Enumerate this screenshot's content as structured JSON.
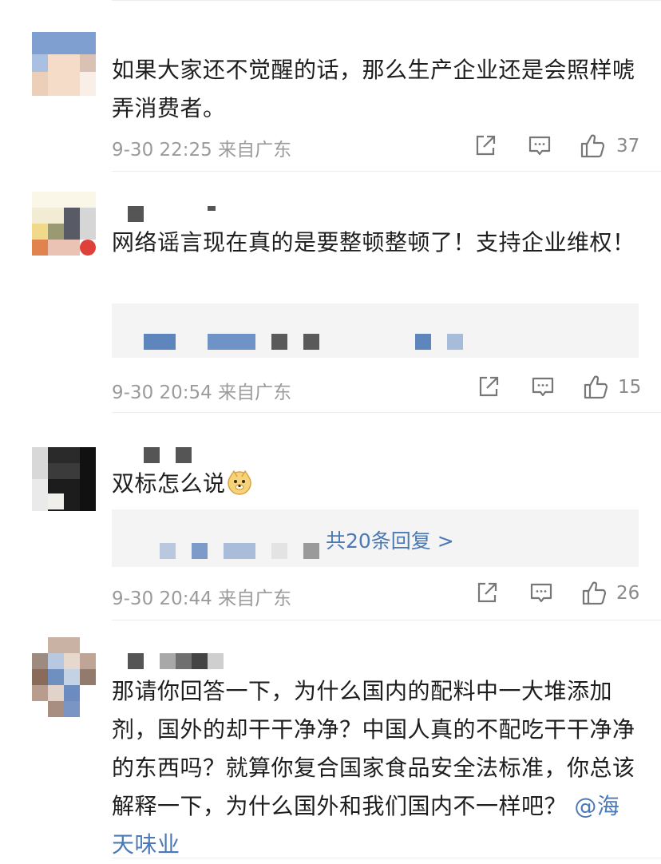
{
  "comments": [
    {
      "text": "如果大家还不觉醒的话，那么生产企业还是会照样唬弄消费者。",
      "time": "9-30 22:25",
      "location": "来自广东",
      "likes": "37",
      "icons": [
        "share-icon",
        "comment-icon",
        "like-icon"
      ]
    },
    {
      "text": "网络谣言现在真的是要整顿整顿了！支持企业维权！",
      "time": "9-30 20:54",
      "location": "来自广东",
      "likes": "15"
    },
    {
      "text": "双标怎么说",
      "emoji": "doge-emoji",
      "time": "9-30 20:44",
      "location": "来自广东",
      "likes": "26",
      "replies_label": "共20条回复 >"
    },
    {
      "text": "那请你回答一下，为什么国内的配料中一大堆添加剂，国外的却干干净净？中国人真的不配吃干干净净的东西吗？就算你复合国家食品安全法标准，你总该解释一下，为什么国外和我们国内不一样吧？",
      "mention": "@海天味业"
    }
  ],
  "colors": {
    "link": "#4a79b6",
    "meta": "#9b9b9b",
    "text": "#1e1e1e"
  }
}
